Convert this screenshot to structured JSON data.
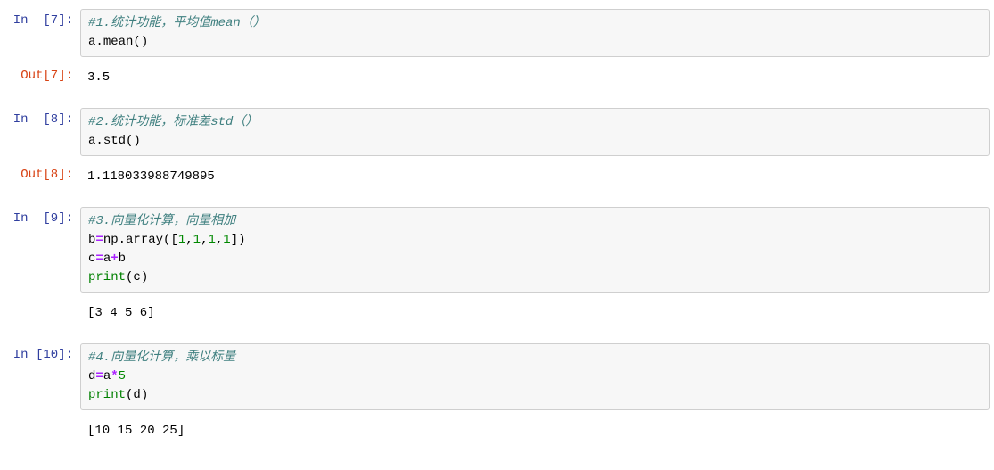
{
  "cells": [
    {
      "prompt_in": "In  [7]:",
      "code_lines": [
        {
          "type": "comment",
          "text": "#1.统计功能，平均值mean（）"
        },
        {
          "type": "code",
          "tokens": [
            {
              "cls": "name",
              "text": "a."
            },
            {
              "cls": "name",
              "text": "mean"
            },
            {
              "cls": "paren",
              "text": "()"
            }
          ]
        }
      ],
      "prompt_out": "Out[7]:",
      "output_text": "3.5",
      "stream_output": null
    },
    {
      "prompt_in": "In  [8]:",
      "code_lines": [
        {
          "type": "comment",
          "text": "#2.统计功能，标准差std（）"
        },
        {
          "type": "code",
          "tokens": [
            {
              "cls": "name",
              "text": "a."
            },
            {
              "cls": "name",
              "text": "std"
            },
            {
              "cls": "paren",
              "text": "()"
            }
          ]
        }
      ],
      "prompt_out": "Out[8]:",
      "output_text": "1.118033988749895",
      "stream_output": null
    },
    {
      "prompt_in": "In  [9]:",
      "code_lines": [
        {
          "type": "comment",
          "text": "#3.向量化计算，向量相加"
        },
        {
          "type": "code",
          "tokens": [
            {
              "cls": "name",
              "text": "b"
            },
            {
              "cls": "operator",
              "text": "="
            },
            {
              "cls": "name",
              "text": "np."
            },
            {
              "cls": "name",
              "text": "array"
            },
            {
              "cls": "paren",
              "text": "(["
            },
            {
              "cls": "number",
              "text": "1"
            },
            {
              "cls": "paren",
              "text": ","
            },
            {
              "cls": "number",
              "text": "1"
            },
            {
              "cls": "paren",
              "text": ","
            },
            {
              "cls": "number",
              "text": "1"
            },
            {
              "cls": "paren",
              "text": ","
            },
            {
              "cls": "number",
              "text": "1"
            },
            {
              "cls": "paren",
              "text": "])"
            }
          ]
        },
        {
          "type": "code",
          "tokens": [
            {
              "cls": "name",
              "text": "c"
            },
            {
              "cls": "operator",
              "text": "="
            },
            {
              "cls": "name",
              "text": "a"
            },
            {
              "cls": "operator",
              "text": "+"
            },
            {
              "cls": "name",
              "text": "b"
            }
          ]
        },
        {
          "type": "code",
          "tokens": [
            {
              "cls": "builtin",
              "text": "print"
            },
            {
              "cls": "paren",
              "text": "("
            },
            {
              "cls": "name",
              "text": "c"
            },
            {
              "cls": "paren",
              "text": ")"
            }
          ]
        }
      ],
      "prompt_out": null,
      "output_text": null,
      "stream_output": "[3 4 5 6]"
    },
    {
      "prompt_in": "In [10]:",
      "code_lines": [
        {
          "type": "comment",
          "text": "#4.向量化计算，乘以标量"
        },
        {
          "type": "code",
          "tokens": [
            {
              "cls": "name",
              "text": "d"
            },
            {
              "cls": "operator",
              "text": "="
            },
            {
              "cls": "name",
              "text": "a"
            },
            {
              "cls": "operator",
              "text": "*"
            },
            {
              "cls": "number",
              "text": "5"
            }
          ]
        },
        {
          "type": "code",
          "tokens": [
            {
              "cls": "builtin",
              "text": "print"
            },
            {
              "cls": "paren",
              "text": "("
            },
            {
              "cls": "name",
              "text": "d"
            },
            {
              "cls": "paren",
              "text": ")"
            }
          ]
        }
      ],
      "prompt_out": null,
      "output_text": null,
      "stream_output": "[10 15 20 25]"
    }
  ]
}
